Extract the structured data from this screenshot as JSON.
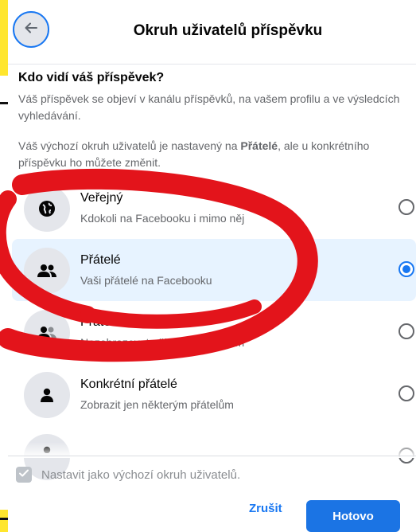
{
  "header": {
    "title": "Okruh uživatelů příspěvku",
    "back_icon": "arrow-left-icon"
  },
  "intro": {
    "heading": "Kdo vidí váš příspěvek?",
    "body": "Váš příspěvek se objeví v kanálu příspěvků, na vašem profilu a ve výsledcích vyhledávání.",
    "default_text_before": "Váš výchozí okruh uživatelů je nastavený na ",
    "default_text_strong": "Přátelé",
    "default_text_after": ", ale u konkrétního příspěvku ho můžete změnit."
  },
  "options": [
    {
      "label": "Veřejný",
      "desc": "Kdokoli na Facebooku i mimo něj",
      "icon": "globe-icon",
      "selected": false
    },
    {
      "label": "Přátelé",
      "desc": "Vaši přátelé na Facebooku",
      "icon": "friends-icon",
      "selected": true
    },
    {
      "label": "Přátelé kromě...",
      "desc": "Nezobrazovat některým přátelům",
      "icon": "friends-except-icon",
      "selected": false
    },
    {
      "label": "Konkrétní přátelé",
      "desc": "Zobrazit jen některým přátelům",
      "icon": "person-icon",
      "selected": false
    }
  ],
  "footer": {
    "default_checkbox_label": "Nastavit jako výchozí okruh uživatelů.",
    "default_checked": true,
    "cancel_label": "Zrušit",
    "done_label": "Hotovo"
  },
  "colors": {
    "accent": "#1877f2",
    "selected_bg": "#e7f3ff",
    "annotation_red": "#e3141b",
    "frame_yellow": "#ffe62e"
  }
}
